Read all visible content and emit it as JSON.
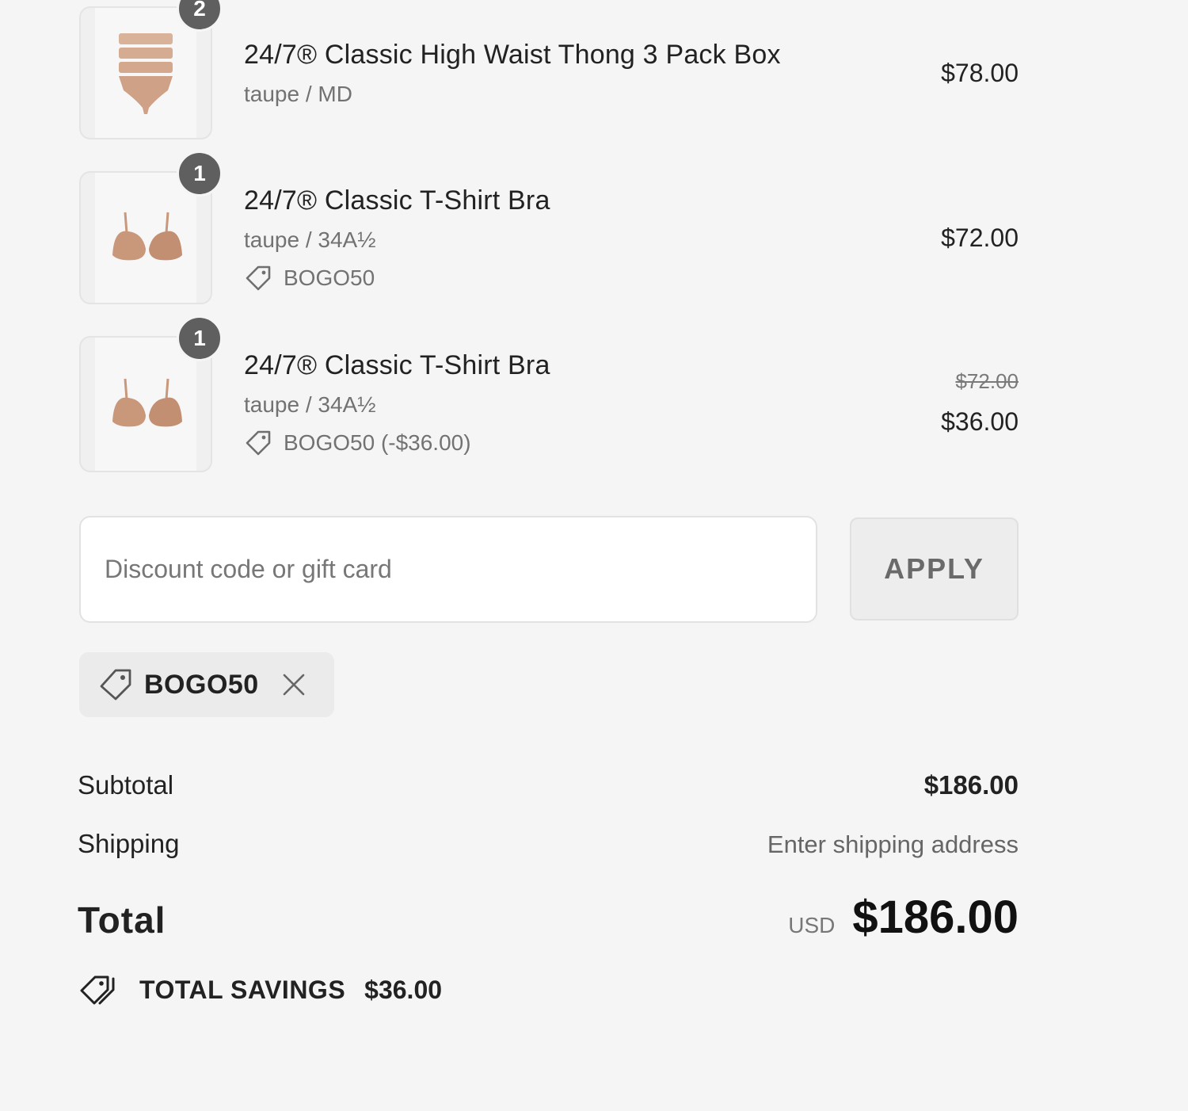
{
  "items": [
    {
      "quantity": "2",
      "title": "24/7® Classic High Waist Thong 3 Pack Box",
      "variant": "taupe / MD",
      "price": "$78.00",
      "image_icon": "thong-product-icon"
    },
    {
      "quantity": "1",
      "title": "24/7® Classic T-Shirt Bra",
      "variant": "taupe / 34A½",
      "discount": "BOGO50",
      "price": "$72.00",
      "image_icon": "bra-product-icon"
    },
    {
      "quantity": "1",
      "title": "24/7® Classic T-Shirt Bra",
      "variant": "taupe / 34A½",
      "discount": "BOGO50 (-$36.00)",
      "original_price": "$72.00",
      "price": "$36.00",
      "image_icon": "bra-product-icon"
    }
  ],
  "discount_form": {
    "placeholder": "Discount code or gift card",
    "value": "",
    "apply_label": "APPLY"
  },
  "applied_code": {
    "label": "BOGO50",
    "remove_icon": "close-icon"
  },
  "summary": {
    "subtotal_label": "Subtotal",
    "subtotal_value": "$186.00",
    "shipping_label": "Shipping",
    "shipping_value": "Enter shipping address",
    "total_label": "Total",
    "currency": "USD",
    "total_value": "$186.00",
    "savings_label": "TOTAL SAVINGS",
    "savings_value": "$36.00"
  },
  "colors": {
    "background": "#f5f5f5",
    "badge": "#5f5f5f",
    "product_tone": "#c9977a"
  }
}
